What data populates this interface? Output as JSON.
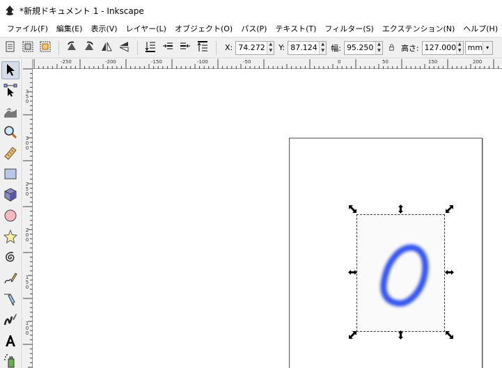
{
  "window": {
    "title": "*新規ドキュメント 1 - Inkscape"
  },
  "menu": [
    "ファイル(F)",
    "編集(E)",
    "表示(V)",
    "レイヤー(L)",
    "オブジェクト(O)",
    "パス(P)",
    "テキスト(T)",
    "フィルター(S)",
    "エクステンション(N)",
    "ヘルプ(H)"
  ],
  "toolbar": {
    "x_label": "X:",
    "x_value": "74.272",
    "y_label": "Y:",
    "y_value": "87.124",
    "w_label": "幅:",
    "w_value": "95.250",
    "h_label": "高さ:",
    "h_value": "127.000",
    "unit": "mm"
  },
  "ruler_top": [
    "-250",
    "-200",
    "-150",
    "-100",
    "-50",
    "0",
    "50",
    "100",
    "150",
    "200"
  ],
  "ruler_left": [
    "3\n5\n0",
    "3\n0\n0",
    "2\n5\n0",
    "2\n0\n0",
    "1\n5\n0",
    "1\n0\n0"
  ],
  "tools": [
    "selector-tool",
    "node-tool",
    "tweak-tool",
    "zoom-tool",
    "measure-tool",
    "rectangle-tool",
    "3d-box-tool",
    "ellipse-tool",
    "star-tool",
    "spiral-tool",
    "pencil-tool",
    "pen-tool",
    "calligraphy-tool",
    "text-tool",
    "spray-tool"
  ],
  "colors": {
    "accent_selection": "#d6dde8",
    "stroke_blue": "#2244ee"
  }
}
